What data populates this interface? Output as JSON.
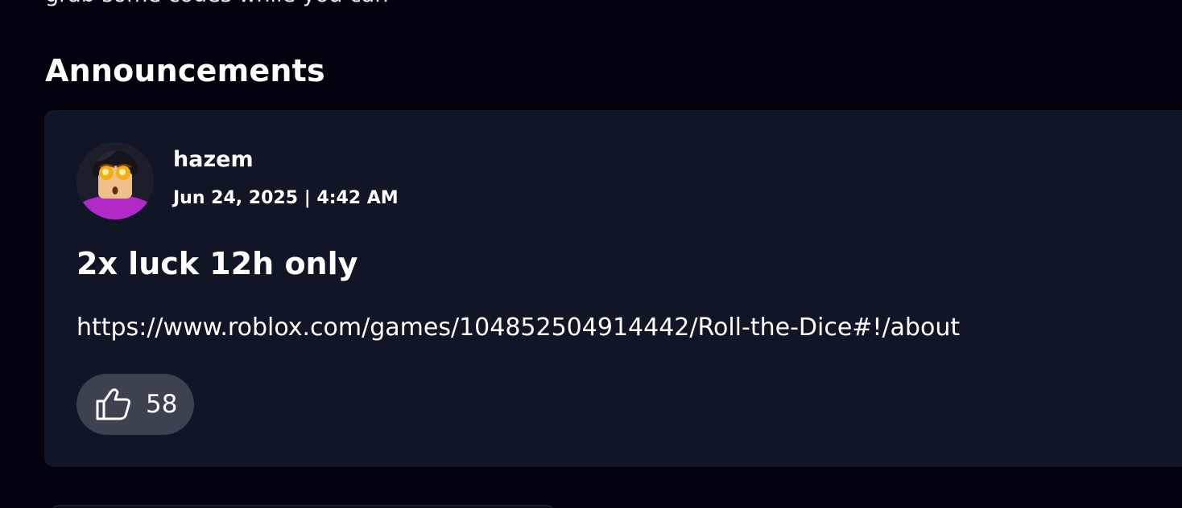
{
  "top_text": "grab some codes while you can",
  "section": {
    "title": "Announcements"
  },
  "announcement": {
    "author": "hazem",
    "timestamp": "Jun 24, 2025 | 4:42 AM",
    "title": "2x luck 12h only",
    "body": "https://www.roblox.com/games/104852504914442/Roll-the-Dice#!/about",
    "likes": "58",
    "like_icon": "thumbs-up-icon",
    "avatar_icon": "user-avatar"
  },
  "colors": {
    "page_background": "#02030f",
    "card_background": "#111626",
    "like_button_background": "#3d4251",
    "text": "#ffffff"
  }
}
